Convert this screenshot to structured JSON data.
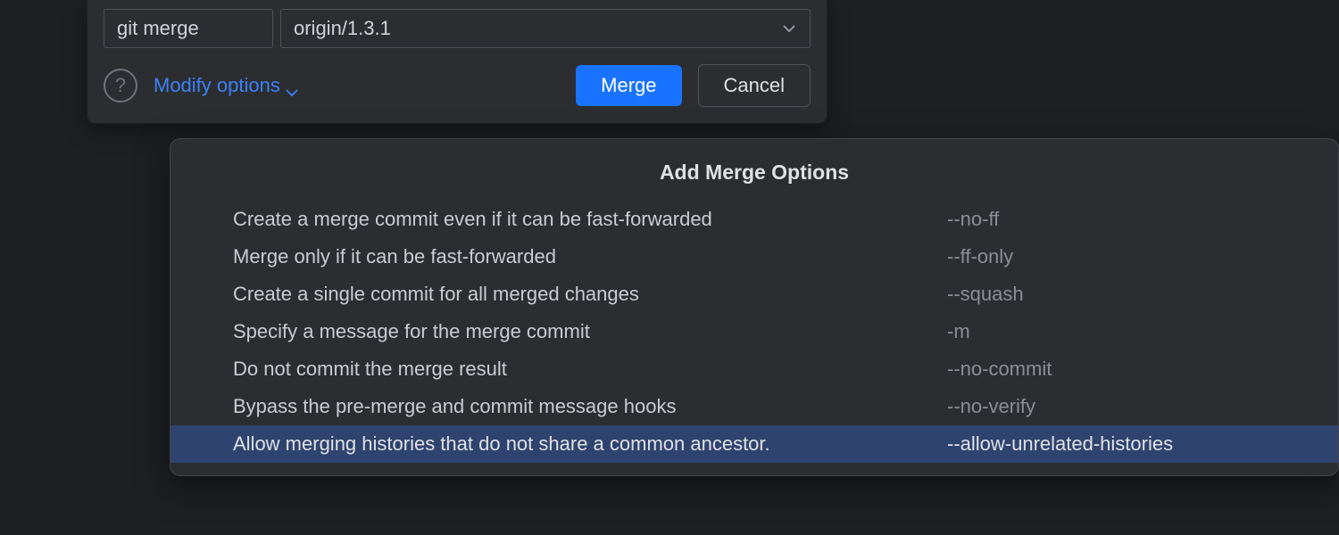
{
  "header": {
    "command": "git merge",
    "branch": "origin/1.3.1",
    "help_symbol": "?",
    "modify_label": "Modify options",
    "merge_label": "Merge",
    "cancel_label": "Cancel"
  },
  "popup": {
    "title": "Add Merge Options",
    "options": [
      {
        "desc": "Create a merge commit even if it can be fast-forwarded",
        "flag": "--no-ff",
        "selected": false
      },
      {
        "desc": "Merge only if it can be fast-forwarded",
        "flag": "--ff-only",
        "selected": false
      },
      {
        "desc": "Create a single commit for all merged changes",
        "flag": "--squash",
        "selected": false
      },
      {
        "desc": "Specify a message for the merge commit",
        "flag": "-m",
        "selected": false
      },
      {
        "desc": "Do not commit the merge result",
        "flag": "--no-commit",
        "selected": false
      },
      {
        "desc": "Bypass the pre-merge and commit message hooks",
        "flag": "--no-verify",
        "selected": false
      },
      {
        "desc": "Allow merging histories that do not share a common ancestor.",
        "flag": "--allow-unrelated-histories",
        "selected": true
      }
    ]
  }
}
